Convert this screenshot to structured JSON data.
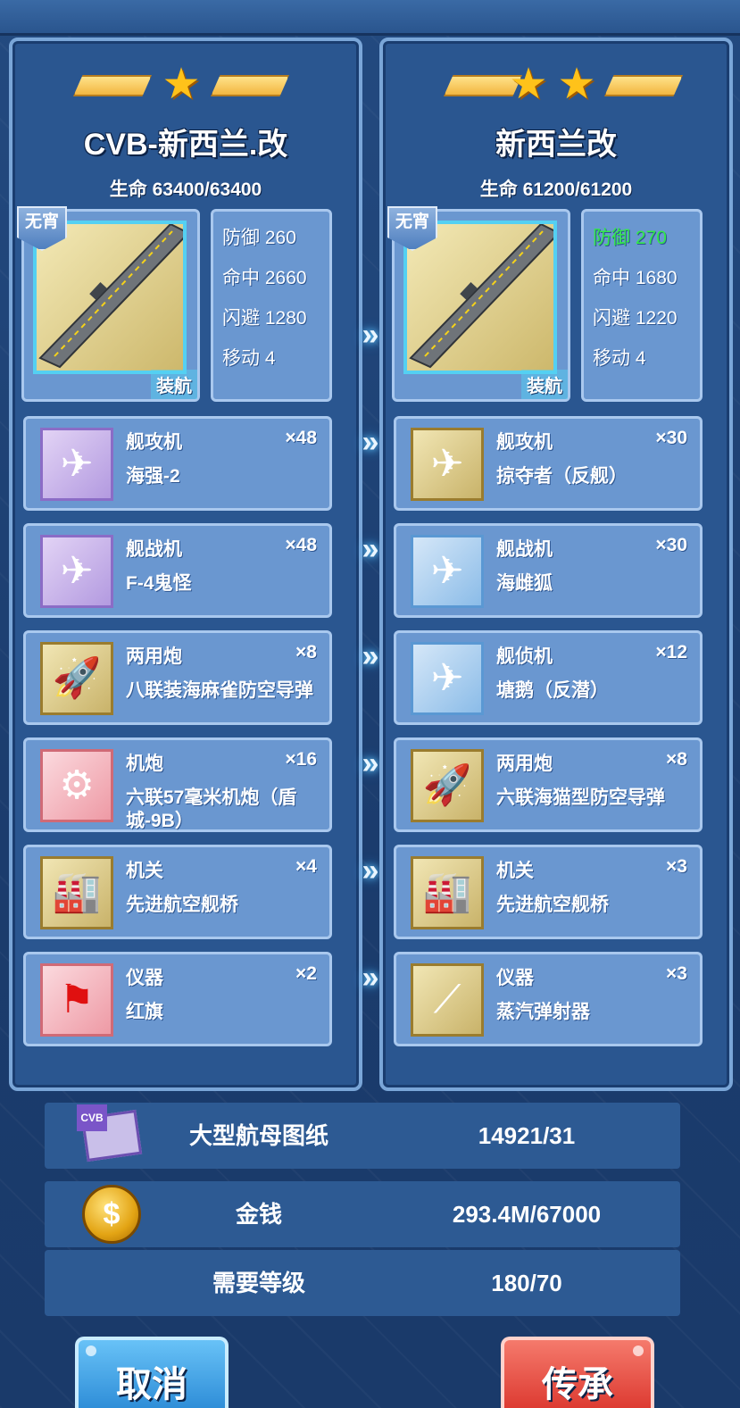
{
  "left": {
    "stars": 1,
    "name": "CVB-新西兰.改",
    "hp": "生命 63400/63400",
    "badge": "无宵",
    "type": "装航",
    "stats": [
      {
        "label": "防御 260",
        "highlight": false
      },
      {
        "label": "命中 2660",
        "highlight": false
      },
      {
        "label": "闪避 1280",
        "highlight": false
      },
      {
        "label": "移动 4",
        "highlight": false
      }
    ],
    "slots": [
      {
        "cat": "舰攻机",
        "count": "×48",
        "name": "海强-2",
        "icon": "plane-icon",
        "tone": "purple"
      },
      {
        "cat": "舰战机",
        "count": "×48",
        "name": "F-4鬼怪",
        "icon": "jet-icon",
        "tone": "purple"
      },
      {
        "cat": "两用炮",
        "count": "×8",
        "name": "八联装海麻雀防空导弹",
        "icon": "missile-icon",
        "tone": "gold"
      },
      {
        "cat": "机炮",
        "count": "×16",
        "name": "六联57毫米机炮（盾城-9B）",
        "icon": "gun-icon",
        "tone": "red"
      },
      {
        "cat": "机关",
        "count": "×4",
        "name": "先进航空舰桥",
        "icon": "bridge-icon",
        "tone": "gold"
      },
      {
        "cat": "仪器",
        "count": "×2",
        "name": "红旗",
        "icon": "flag-icon",
        "tone": "red"
      }
    ]
  },
  "right": {
    "stars": 2,
    "name": "新西兰改",
    "hp": "生命 61200/61200",
    "badge": "无宵",
    "type": "装航",
    "stats": [
      {
        "label": "防御 270",
        "highlight": true
      },
      {
        "label": "命中 1680",
        "highlight": false
      },
      {
        "label": "闪避 1220",
        "highlight": false
      },
      {
        "label": "移动 4",
        "highlight": false
      }
    ],
    "slots": [
      {
        "cat": "舰攻机",
        "count": "×30",
        "name": "掠夺者（反舰）",
        "icon": "jet-icon",
        "tone": "gold"
      },
      {
        "cat": "舰战机",
        "count": "×30",
        "name": "海雌狐",
        "icon": "jet-icon",
        "tone": "blue"
      },
      {
        "cat": "舰侦机",
        "count": "×12",
        "name": "塘鹅（反潜）",
        "icon": "plane-icon",
        "tone": "blue"
      },
      {
        "cat": "两用炮",
        "count": "×8",
        "name": "六联海猫型防空导弹",
        "icon": "missile-icon",
        "tone": "gold"
      },
      {
        "cat": "机关",
        "count": "×3",
        "name": "先进航空舰桥",
        "icon": "bridge-icon",
        "tone": "gold"
      },
      {
        "cat": "仪器",
        "count": "×3",
        "name": "蒸汽弹射器",
        "icon": "catapult-icon",
        "tone": "gold"
      }
    ]
  },
  "costs": [
    {
      "label": "大型航母图纸",
      "value": "14921/31",
      "icon": "blueprint-icon"
    },
    {
      "label": "金钱",
      "value": "293.4M/67000",
      "icon": "coin-icon"
    },
    {
      "label": "需要等级",
      "value": "180/70",
      "icon": ""
    }
  ],
  "buttons": {
    "cancel": "取消",
    "inherit": "传承"
  },
  "colors": {
    "highlight": "#33e84a",
    "panel": "#2a5690",
    "slot": "#6a97d0"
  }
}
